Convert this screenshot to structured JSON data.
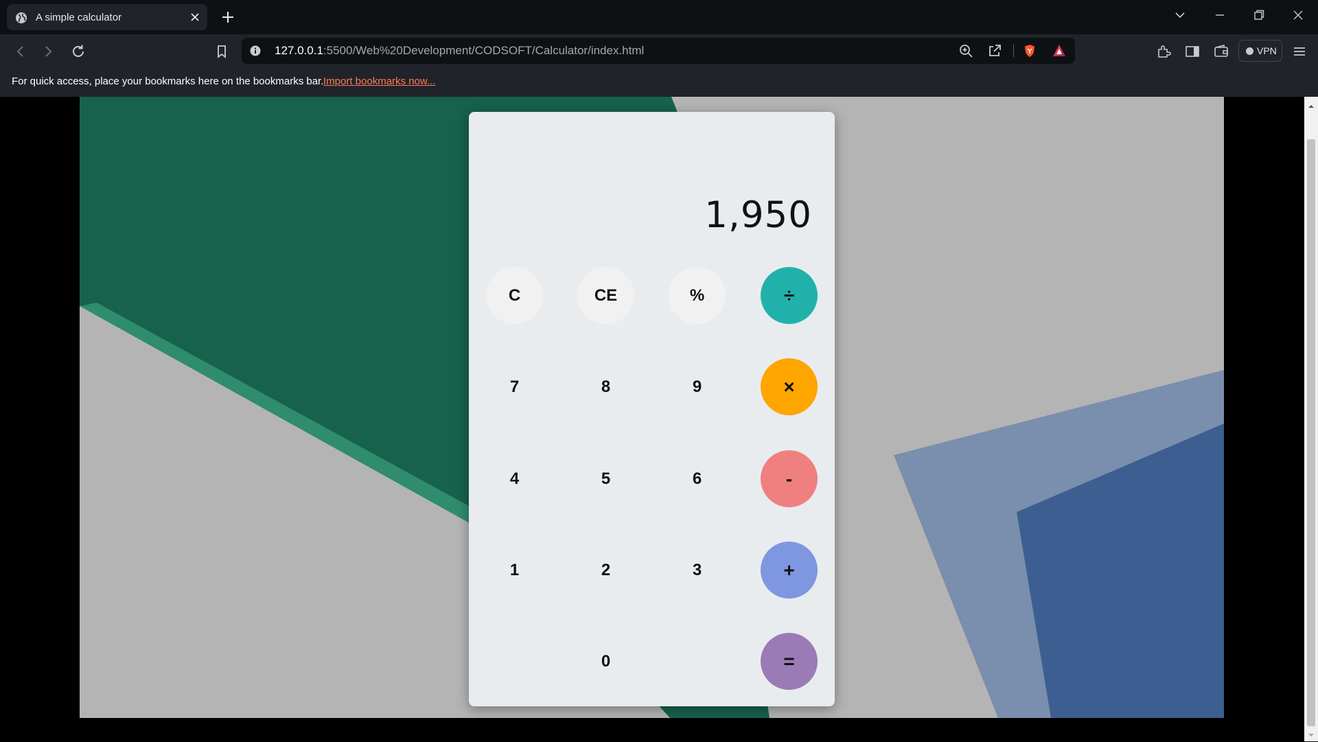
{
  "browser": {
    "tab": {
      "title": "A simple calculator"
    },
    "address": {
      "host": "127.0.0.1",
      "path": ":5500/Web%20Development/CODSOFT/Calculator/index.html"
    },
    "vpn_label": "VPN",
    "bookmarks_bar": {
      "message": "For quick access, place your bookmarks here on the bookmarks bar.",
      "import_link": "Import bookmarks now..."
    }
  },
  "calculator": {
    "display": "1,950",
    "keys": {
      "clear": "C",
      "clear_entry": "CE",
      "percent": "%",
      "divide": "÷",
      "seven": "7",
      "eight": "8",
      "nine": "9",
      "multiply": "×",
      "four": "4",
      "five": "5",
      "six": "6",
      "subtract": "-",
      "one": "1",
      "two": "2",
      "three": "3",
      "add": "+",
      "zero": "0",
      "equals": "="
    },
    "colors": {
      "function_key_bg": "#f1f1f1",
      "divide": "#20b2aa",
      "multiply": "#ffa500",
      "subtract": "#f08080",
      "add": "#7f96e0",
      "equals": "#9a7bb6"
    }
  },
  "background_colors": {
    "green": "#17624c",
    "gray": "#b4b4b4",
    "blue": "#3d5e90"
  }
}
